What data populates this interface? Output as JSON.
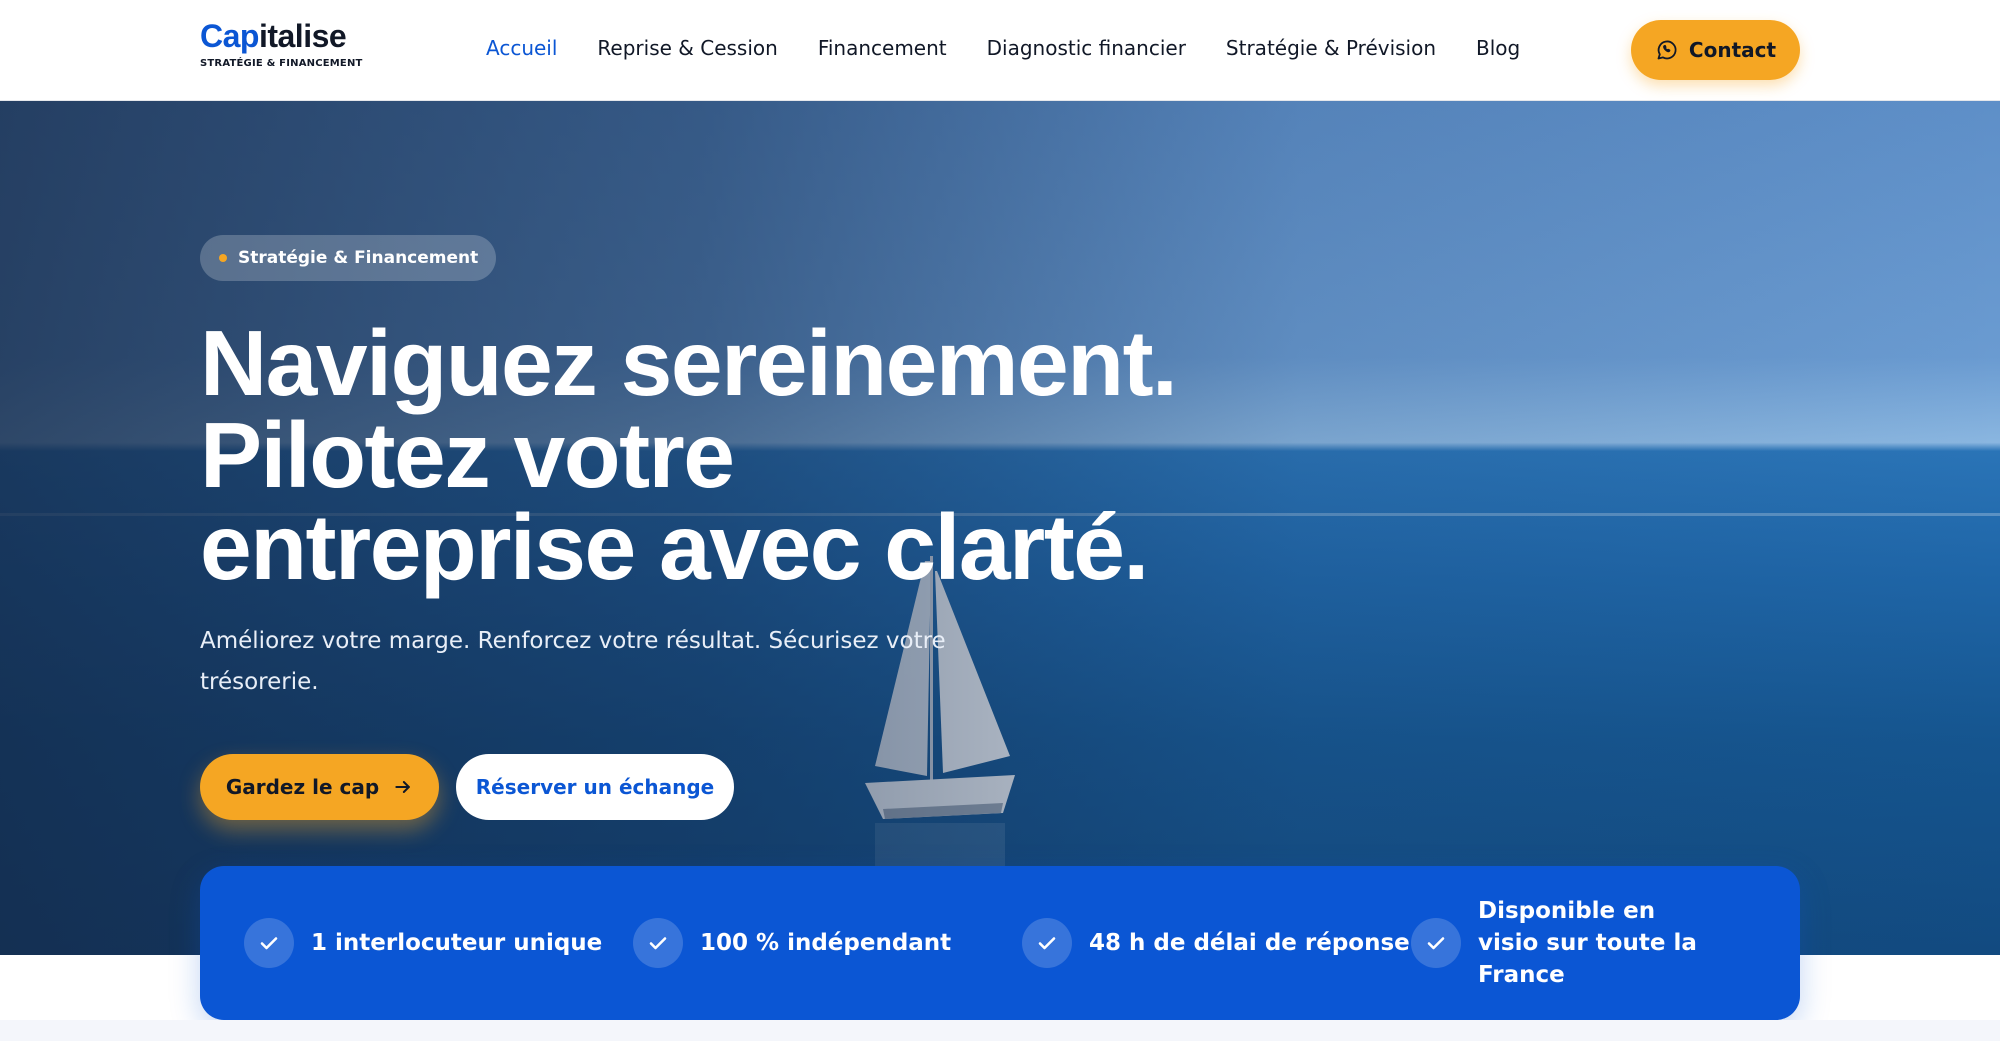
{
  "brand": {
    "name_part1": "Cap",
    "name_part2": "italise",
    "tagline": "STRATÉGIE & FINANCEMENT"
  },
  "nav": {
    "items": [
      {
        "label": "Accueil",
        "active": true
      },
      {
        "label": "Reprise & Cession",
        "active": false
      },
      {
        "label": "Financement",
        "active": false
      },
      {
        "label": "Diagnostic financier",
        "active": false
      },
      {
        "label": "Stratégie & Prévision",
        "active": false
      },
      {
        "label": "Blog",
        "active": false
      }
    ],
    "contact_label": "Contact",
    "contact_icon": "whatsapp-icon"
  },
  "hero": {
    "badge": "Stratégie & Financement",
    "title_lines": [
      "Naviguez sereinement.",
      "Pilotez votre",
      "entreprise avec clarté."
    ],
    "subtitle": "Améliorez votre marge. Renforcez votre résultat. Sécurisez votre trésorerie.",
    "primary_cta": "Gardez le cap",
    "primary_cta_icon": "arrow-right-icon",
    "secondary_cta": "Réserver un échange"
  },
  "features": [
    {
      "label": "1 interlocuteur unique",
      "icon": "check-icon"
    },
    {
      "label": "100 % indépendant",
      "icon": "check-icon"
    },
    {
      "label": "48 h de délai de réponse",
      "icon": "check-icon"
    },
    {
      "label": "Disponible en visio sur toute la France",
      "icon": "check-icon"
    }
  ],
  "colors": {
    "brand_blue": "#0b56d4",
    "accent_orange": "#f5a623",
    "text_dark": "#111827"
  }
}
